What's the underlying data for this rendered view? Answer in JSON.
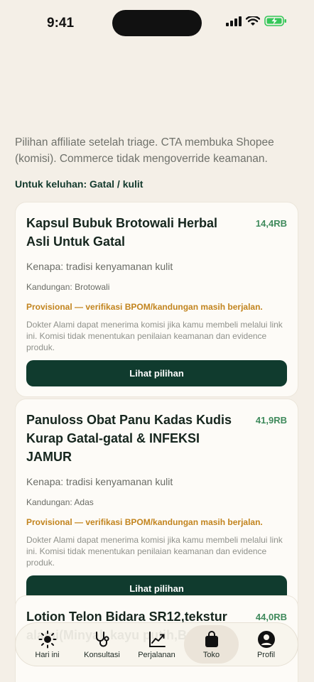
{
  "status_bar": {
    "time": "9:41"
  },
  "intro_text": "Pilihan affiliate setelah triage. CTA membuka Shopee (komisi). Commerce tidak mengoverride keamanan.",
  "complaint_label": "Untuk keluhan: Gatal / kulit",
  "products": [
    {
      "title": "Kapsul Bubuk Brotowali Herbal Asli Untuk Gatal",
      "price": "14,4RB",
      "reason": "Kenapa: tradisi kenyamanan kulit",
      "ingredients": "Kandungan: Brotowali",
      "provisional": "Provisional — verifikasi BPOM/kandungan masih berjalan.",
      "disclaimer": "Dokter Alami dapat menerima komisi jika kamu membeli melalui link ini. Komisi tidak menentukan penilaian keamanan dan evidence produk.",
      "cta": "Lihat pilihan"
    },
    {
      "title": "Panuloss Obat Panu Kadas Kudis Kurap Gatal-gatal & INFEKSI JAMUR",
      "price": "41,9RB",
      "reason": "Kenapa: tradisi kenyamanan kulit",
      "ingredients": "Kandungan: Adas",
      "provisional": "Provisional — verifikasi BPOM/kandungan masih berjalan.",
      "disclaimer": "Dokter Alami dapat menerima komisi jika kamu membeli melalui link ini. Komisi tidak menentukan penilaian keamanan dan evidence produk.",
      "cta": "Lihat pilihan"
    },
    {
      "title": "Lotion Telon Bidara SR12,tekstur alami(Minyak kayu putih,Bunga",
      "price": "44,0RB"
    }
  ],
  "tabs": [
    {
      "label": "Hari ini",
      "icon": "sun-icon"
    },
    {
      "label": "Konsultasi",
      "icon": "stethoscope-icon"
    },
    {
      "label": "Perjalanan",
      "icon": "chart-icon"
    },
    {
      "label": "Toko",
      "icon": "shopping-bag-icon",
      "active": true
    },
    {
      "label": "Profil",
      "icon": "profile-icon"
    }
  ],
  "colors": {
    "background": "#f4efe7",
    "primary": "#103b2e",
    "price": "#3f8a5c",
    "warning": "#c2841e"
  }
}
